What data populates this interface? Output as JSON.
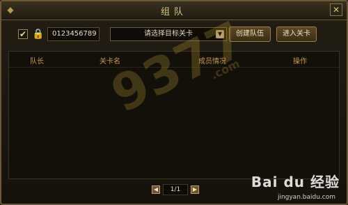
{
  "window": {
    "title": "组队",
    "close_symbol": "✕",
    "corner_symbol": "◆"
  },
  "toolbar": {
    "checkbox_mark": "✔",
    "lock_symbol": "🔒",
    "room_id": "0123456789",
    "stage_select_value": "请选择目标关卡",
    "select_arrow": "▼",
    "create_team_label": "创建队伍",
    "enter_stage_label": "进入关卡"
  },
  "table": {
    "columns": [
      "队长",
      "关卡名",
      "成员情况",
      "操作"
    ]
  },
  "watermark": {
    "big": "9377",
    "small": ".com"
  },
  "pager": {
    "prev": "◀",
    "next": "▶",
    "label": "1/1"
  },
  "overlay": {
    "brand": "Bai du 经验",
    "url": "jingyan.baidu.com"
  }
}
